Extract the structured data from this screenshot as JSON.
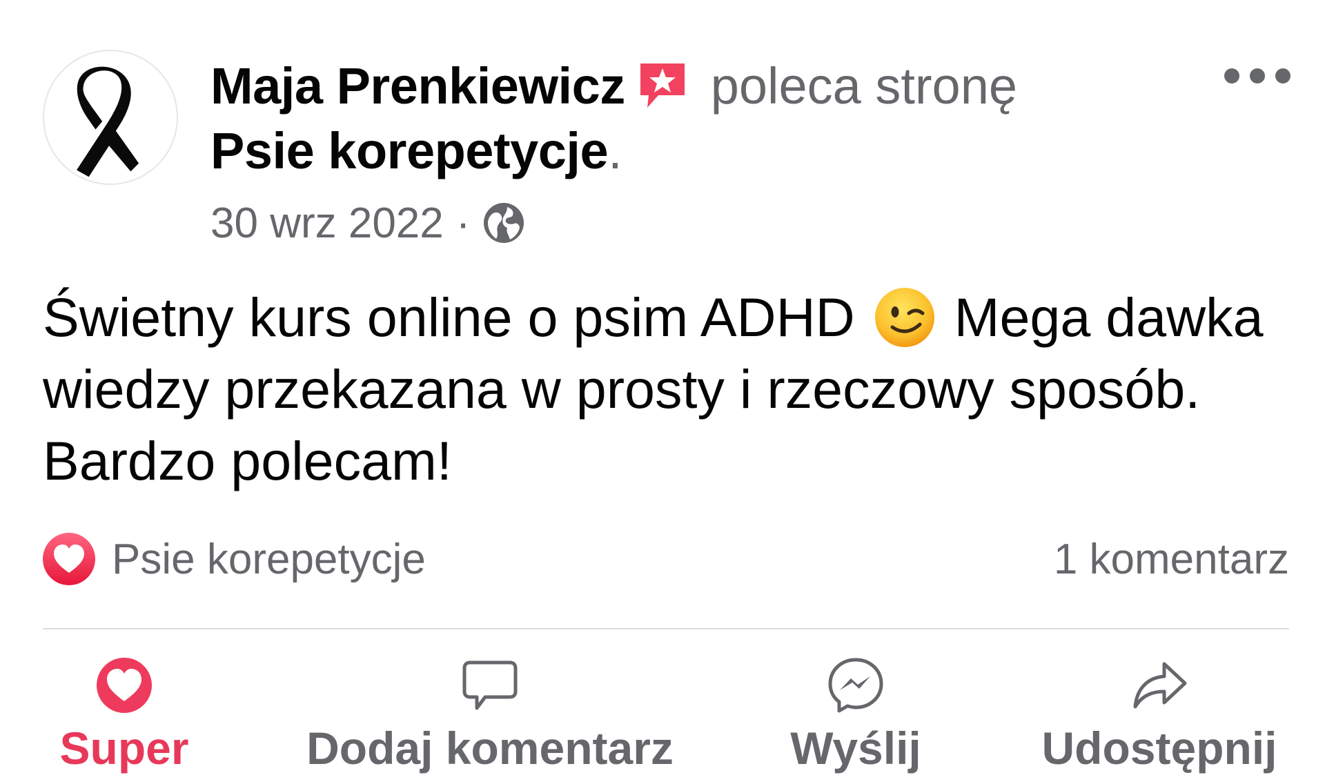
{
  "post": {
    "author": "Maja Prenkiewicz",
    "action": "poleca stronę",
    "page": "Psie korepetycje",
    "page_suffix": ".",
    "date": "30 wrz 2022",
    "separator": "·",
    "privacy_icon": "globe-icon",
    "body_line1_a": "Świetny kurs online o psim ADHD",
    "body_line1_b": "Mega dawka",
    "body_line2": "wiedzy przekazana w prosty i rzeczowy sposób.",
    "body_line3": "Bardzo polecam!"
  },
  "reactions": {
    "icon": "heart-icon",
    "label": "Psie korepetycje",
    "comments": "1 komentarz"
  },
  "actions": {
    "super": "Super",
    "comment": "Dodaj komentarz",
    "send": "Wyślij",
    "share": "Udostępnij"
  },
  "colors": {
    "accent": "#e8385a",
    "secondary_text": "#65676b",
    "primary_text": "#050505",
    "divider": "#dadde1"
  }
}
